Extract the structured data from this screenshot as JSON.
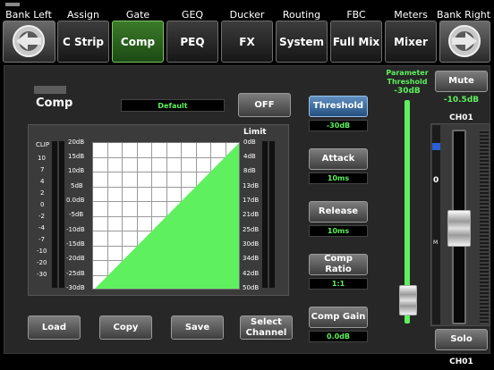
{
  "header": {
    "bank_left": "Bank Left",
    "bank_right": "Bank Right",
    "tabs": [
      {
        "label": "C Strip",
        "group": "Assign"
      },
      {
        "label": "Comp",
        "group": "Gate"
      },
      {
        "label": "PEQ",
        "group": "GEQ"
      },
      {
        "label": "FX",
        "group": "Ducker"
      },
      {
        "label": "System",
        "group": "Routing"
      },
      {
        "label": "Full Mix",
        "group": "FBC"
      },
      {
        "label": "Mixer",
        "group": "Meters"
      }
    ],
    "active_tab": "Comp"
  },
  "panel": {
    "title": "Comp",
    "preset": "Default",
    "off_label": "OFF",
    "limit_label": "Limit"
  },
  "graph": {
    "left_scale": [
      "CLIP",
      "10",
      "7",
      "4",
      "2",
      "0",
      "-2",
      "-4",
      "-7",
      "-10",
      "-20",
      "-30"
    ],
    "input_scale": [
      "20dB",
      "15dB",
      "10dB",
      "5dB",
      "0.0dB",
      "-5dB",
      "-10dB",
      "-15dB",
      "-20dB",
      "-25dB",
      "-30dB"
    ],
    "output_scale": [
      "0dB",
      "4dB",
      "8dB",
      "13dB",
      "17dB",
      "21dB",
      "25dB",
      "30dB",
      "34dB",
      "42dB",
      "50dB"
    ],
    "curve_color": "#5ff05f"
  },
  "params": {
    "threshold": {
      "label": "Threshold",
      "value": "-30dB"
    },
    "attack": {
      "label": "Attack",
      "value": "10ms"
    },
    "release": {
      "label": "Release",
      "value": "10ms"
    },
    "ratio": {
      "label": "Comp Ratio",
      "value": "1:1"
    },
    "gain": {
      "label": "Comp Gain",
      "value": "0.0dB"
    }
  },
  "slider": {
    "title_line1": "Parameter",
    "title_line2": "Threshold",
    "value": "-30dB",
    "level": 0.04
  },
  "channel": {
    "mute_label": "Mute",
    "level": "-10.5dB",
    "name": "CH01",
    "name_bottom": "CH01",
    "solo_label": "Solo",
    "zero_mark": "0",
    "m_mark": "M"
  },
  "bottom": {
    "load": "Load",
    "copy": "Copy",
    "save": "Save",
    "select_channel": "Select Channel"
  }
}
